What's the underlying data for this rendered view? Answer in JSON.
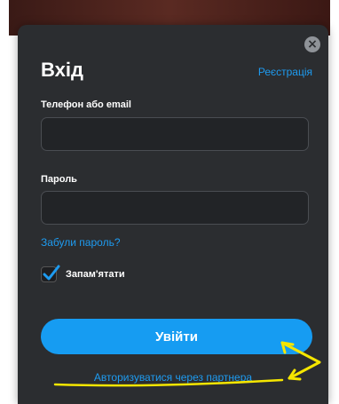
{
  "modal": {
    "title": "Вхід",
    "register_label": "Реєстрація",
    "close_symbol": "×"
  },
  "form": {
    "login_label": "Телефон або email",
    "login_value": "",
    "password_label": "Пароль",
    "password_value": "",
    "forgot_label": "Забули пароль?",
    "remember_label": "Запам'ятати",
    "remember_checked": true,
    "submit_label": "Увійти",
    "partner_label": "Авторизуватися через партнера"
  },
  "colors": {
    "accent": "#169cf2",
    "modal_bg": "#2b2d30",
    "annotation": "#f5e600"
  }
}
